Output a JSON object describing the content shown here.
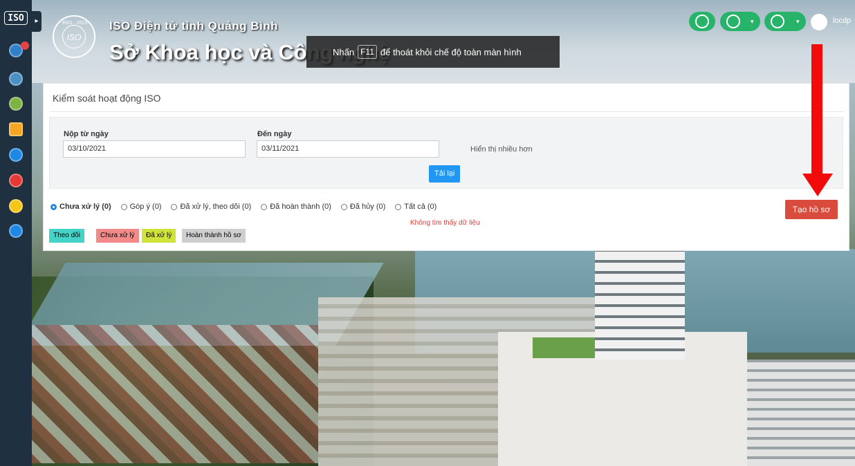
{
  "header": {
    "subtitle": "ISO Điện tử tỉnh Quảng Bình",
    "title": "Sở Khoa học và Công nghệ",
    "logo_text": "ISO",
    "logo_arc_text": "9001 : 2015"
  },
  "sidebar": {
    "logo_text": "ISO",
    "toggle_icon": "caret-right-icon",
    "items": [
      {
        "icon": "info-icon",
        "color": "#2f80c7"
      },
      {
        "icon": "document-icon",
        "color": "#4a90c2"
      },
      {
        "icon": "clipboard-icon",
        "color": "#7cb342"
      },
      {
        "icon": "folder-icon",
        "color": "#f6a623"
      },
      {
        "icon": "users-icon",
        "color": "#1e88e5"
      },
      {
        "icon": "chart-icon",
        "color": "#e53935"
      },
      {
        "icon": "moon-icon",
        "color": "#f5c518"
      },
      {
        "icon": "search-icon",
        "color": "#1e88e5"
      }
    ]
  },
  "fullscreen_toast": {
    "prefix": "Nhấn",
    "key": "F11",
    "suffix": "để thoát khỏi chế độ toàn màn hình"
  },
  "topbar": {
    "home_icon": "home-icon",
    "globe_icon": "globe-icon",
    "help_icon": "help-icon",
    "user": "locdp"
  },
  "panel": {
    "title": "Kiểm soát hoạt động ISO",
    "from_label": "Nộp từ ngày",
    "from_value": "03/10/2021",
    "to_label": "Đến ngày",
    "to_value": "03/11/2021",
    "more_link": "Hiển thị nhiều hơn",
    "reload_button": "Tải lại",
    "statuses": [
      {
        "label": "Chưa xử lý (0)",
        "selected": true
      },
      {
        "label": "Góp ý (0)",
        "selected": false
      },
      {
        "label": "Đã xử lý, theo dõi (0)",
        "selected": false
      },
      {
        "label": "Đã hoàn thành (0)",
        "selected": false
      },
      {
        "label": "Đã hủy (0)",
        "selected": false
      },
      {
        "label": "Tất cả (0)",
        "selected": false
      }
    ],
    "no_data": "Không tìm thấy dữ liệu",
    "create_button": "Tạo hồ sơ",
    "legend": [
      {
        "label": "Theo dõi",
        "color": "#45d3c8"
      },
      {
        "label": "Chưa xử lý",
        "color": "#f28a8a"
      },
      {
        "label": "Đã xử lý",
        "color": "#cfe33a"
      },
      {
        "label": "Hoàn thành hồ sơ",
        "color": "#cfcfcf"
      }
    ]
  },
  "colors": {
    "accent_green": "#27b36a",
    "create_red": "#d94b3d",
    "reload_blue": "#2196f3",
    "annotation_arrow": "#f10b0b"
  }
}
